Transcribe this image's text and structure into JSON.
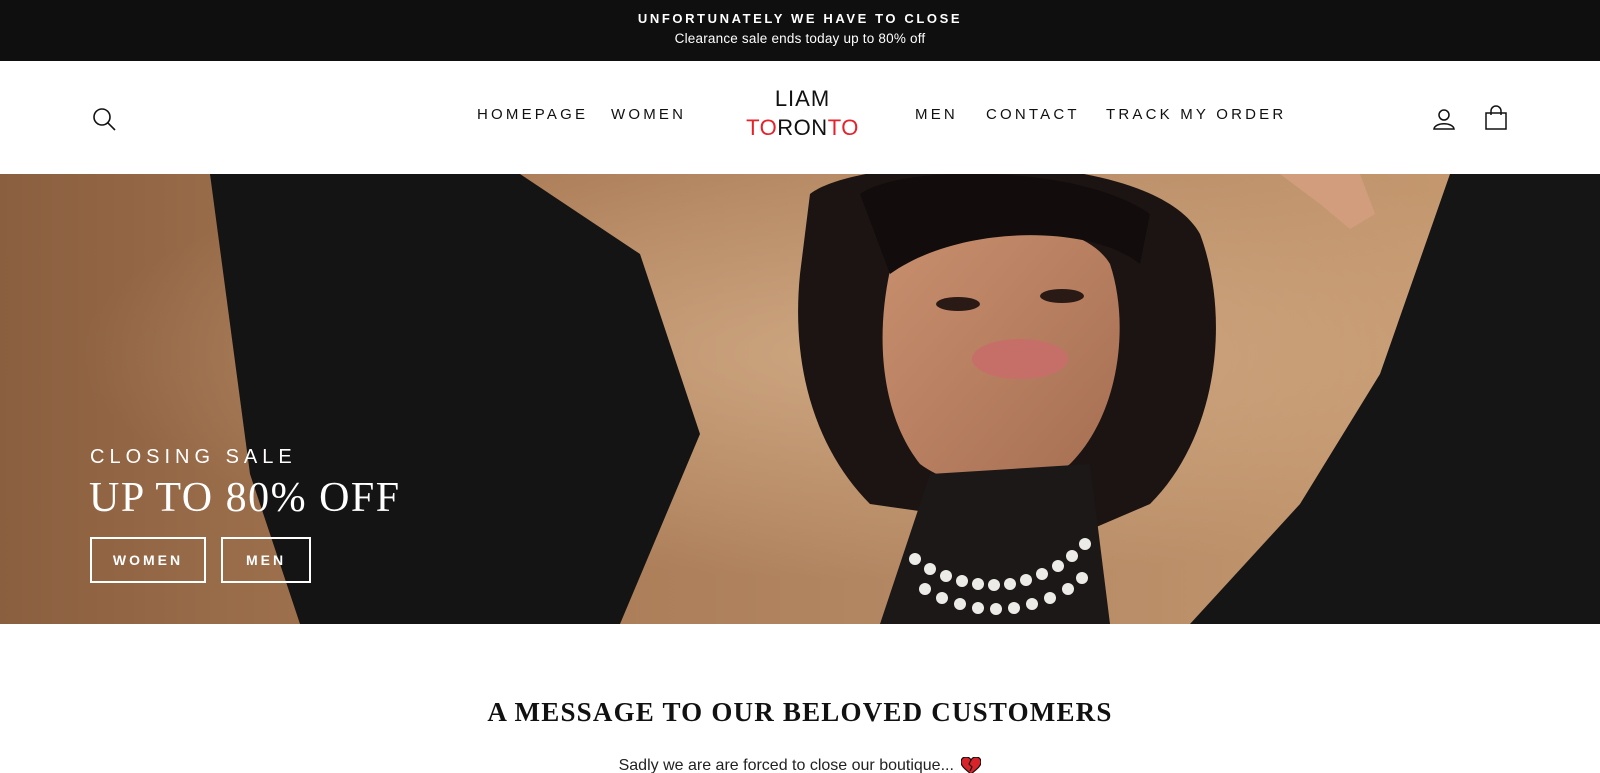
{
  "announcement": {
    "headline": "UNFORTUNATELY WE HAVE TO CLOSE",
    "subline": "Clearance sale ends today up to 80% off"
  },
  "header": {
    "logo": {
      "top": "LIAM",
      "bottom_parts": [
        "TO",
        "RON",
        "TO"
      ]
    },
    "nav": {
      "homepage": "HOMEPAGE",
      "women": "WOMEN",
      "men": "MEN",
      "contact": "CONTACT",
      "track": "TRACK MY ORDER"
    },
    "icons": {
      "search": "search-icon",
      "account": "account-icon",
      "cart": "cart-icon"
    }
  },
  "hero": {
    "eyebrow": "CLOSING SALE",
    "title": "UP TO 80% OFF",
    "buttons": {
      "women": "WOMEN",
      "men": "MEN"
    }
  },
  "message": {
    "title": "A MESSAGE TO OUR BELOVED CUSTOMERS",
    "body": "Sadly we are are forced to close our boutique..."
  },
  "colors": {
    "announcement_bg": "#0f0f0f",
    "logo_accent": "#e8202a",
    "hero_bg": "#b48964"
  }
}
